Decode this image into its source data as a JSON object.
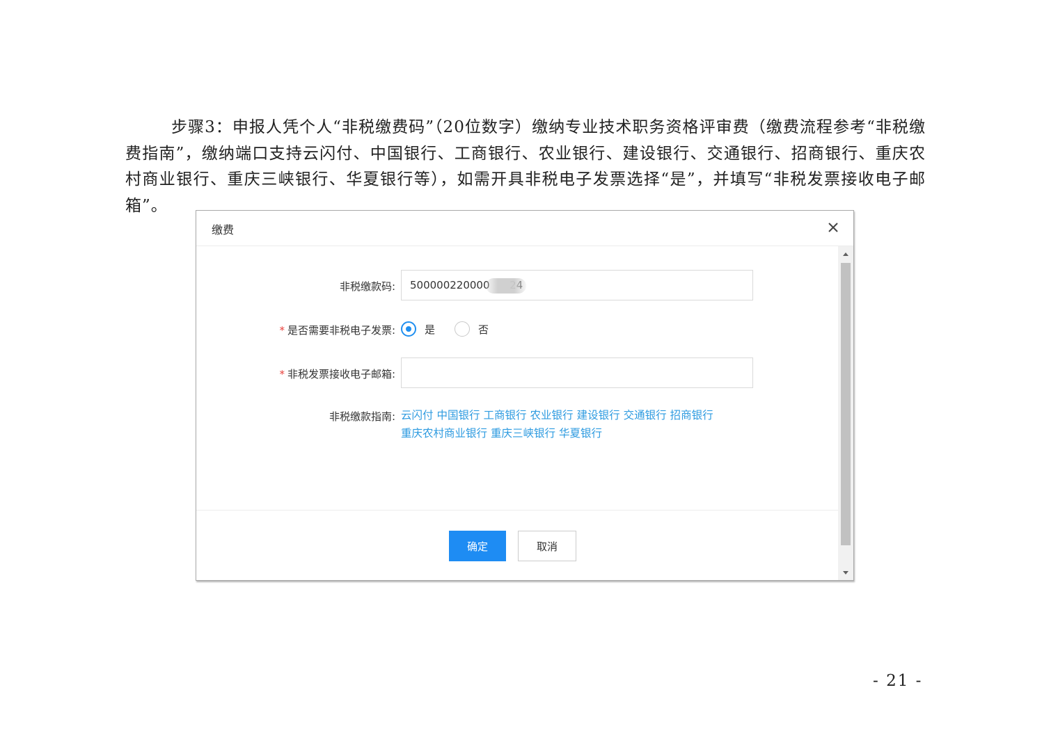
{
  "document": {
    "paragraph": "步骤3：申报人凭个人“非税缴费码”（20位数字）缴纳专业技术职务资格评审费（缴费流程参考“非税缴费指南”，缴纳端口支持云闪付、中国银行、工商银行、农业银行、建设银行、交通银行、招商银行、重庆农村商业银行、重庆三峡银行、华夏银行等），如需开具非税电子发票选择“是”，并填写“非税发票接收电子邮箱”。",
    "page_number": "- 21 -"
  },
  "dialog": {
    "title": "缴费",
    "close_icon": "close-icon",
    "form": {
      "payment_code": {
        "label": "非税缴款码:",
        "value": "500000220000      24"
      },
      "need_invoice": {
        "required_mark": "*",
        "label": "是否需要非税电子发票:",
        "options": [
          {
            "label": "是",
            "checked": true
          },
          {
            "label": "否",
            "checked": false
          }
        ]
      },
      "invoice_email": {
        "required_mark": "*",
        "label": "非税发票接收电子邮箱:",
        "value": ""
      },
      "guide": {
        "label": "非税缴款指南:",
        "links": [
          "云闪付",
          "中国银行",
          "工商银行",
          "农业银行",
          "建设银行",
          "交通银行",
          "招商银行",
          "重庆农村商业银行",
          "重庆三峡银行",
          "华夏银行"
        ]
      }
    },
    "buttons": {
      "confirm": "确定",
      "cancel": "取消"
    },
    "colors": {
      "primary": "#1e8cf3",
      "link": "#2e9be0",
      "required": "#e8403b"
    }
  }
}
